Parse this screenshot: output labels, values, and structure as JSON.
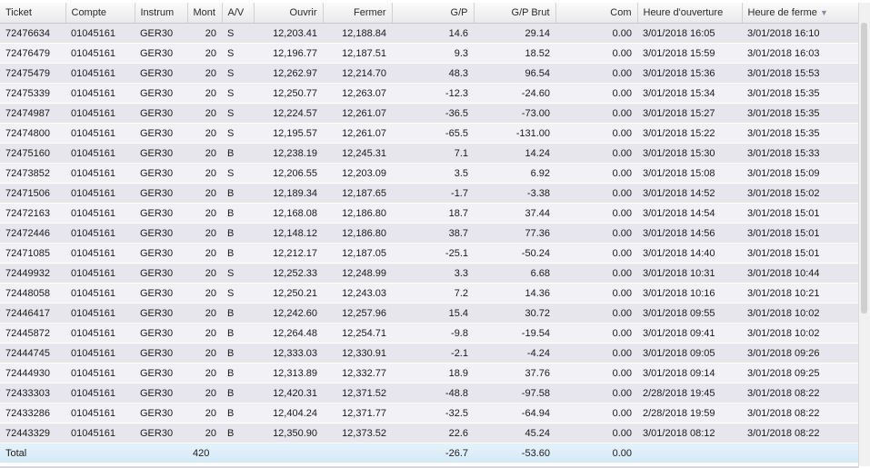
{
  "columns": [
    "Ticket",
    "Compte",
    "Instrum",
    "Mont",
    "A/V",
    "Ouvrir",
    "Fermer",
    "G/P",
    "G/P Brut",
    "Com",
    "Heure d'ouverture",
    "Heure de ferme"
  ],
  "sort_icon": "▼",
  "rows": [
    [
      "72476634",
      "01045161",
      "GER30",
      "20",
      "S",
      "12,203.41",
      "12,188.84",
      "14.6",
      "29.14",
      "0.00",
      "3/01/2018 16:05",
      "3/01/2018 16:10"
    ],
    [
      "72476479",
      "01045161",
      "GER30",
      "20",
      "S",
      "12,196.77",
      "12,187.51",
      "9.3",
      "18.52",
      "0.00",
      "3/01/2018 15:59",
      "3/01/2018 16:03"
    ],
    [
      "72475479",
      "01045161",
      "GER30",
      "20",
      "S",
      "12,262.97",
      "12,214.70",
      "48.3",
      "96.54",
      "0.00",
      "3/01/2018 15:36",
      "3/01/2018 15:53"
    ],
    [
      "72475339",
      "01045161",
      "GER30",
      "20",
      "S",
      "12,250.77",
      "12,263.07",
      "-12.3",
      "-24.60",
      "0.00",
      "3/01/2018 15:34",
      "3/01/2018 15:35"
    ],
    [
      "72474987",
      "01045161",
      "GER30",
      "20",
      "S",
      "12,224.57",
      "12,261.07",
      "-36.5",
      "-73.00",
      "0.00",
      "3/01/2018 15:27",
      "3/01/2018 15:35"
    ],
    [
      "72474800",
      "01045161",
      "GER30",
      "20",
      "S",
      "12,195.57",
      "12,261.07",
      "-65.5",
      "-131.00",
      "0.00",
      "3/01/2018 15:22",
      "3/01/2018 15:35"
    ],
    [
      "72475160",
      "01045161",
      "GER30",
      "20",
      "B",
      "12,238.19",
      "12,245.31",
      "7.1",
      "14.24",
      "0.00",
      "3/01/2018 15:30",
      "3/01/2018 15:33"
    ],
    [
      "72473852",
      "01045161",
      "GER30",
      "20",
      "S",
      "12,206.55",
      "12,203.09",
      "3.5",
      "6.92",
      "0.00",
      "3/01/2018 15:08",
      "3/01/2018 15:09"
    ],
    [
      "72471506",
      "01045161",
      "GER30",
      "20",
      "B",
      "12,189.34",
      "12,187.65",
      "-1.7",
      "-3.38",
      "0.00",
      "3/01/2018 14:52",
      "3/01/2018 15:02"
    ],
    [
      "72472163",
      "01045161",
      "GER30",
      "20",
      "B",
      "12,168.08",
      "12,186.80",
      "18.7",
      "37.44",
      "0.00",
      "3/01/2018 14:54",
      "3/01/2018 15:01"
    ],
    [
      "72472446",
      "01045161",
      "GER30",
      "20",
      "B",
      "12,148.12",
      "12,186.80",
      "38.7",
      "77.36",
      "0.00",
      "3/01/2018 14:56",
      "3/01/2018 15:01"
    ],
    [
      "72471085",
      "01045161",
      "GER30",
      "20",
      "B",
      "12,212.17",
      "12,187.05",
      "-25.1",
      "-50.24",
      "0.00",
      "3/01/2018 14:40",
      "3/01/2018 15:01"
    ],
    [
      "72449932",
      "01045161",
      "GER30",
      "20",
      "S",
      "12,252.33",
      "12,248.99",
      "3.3",
      "6.68",
      "0.00",
      "3/01/2018 10:31",
      "3/01/2018 10:44"
    ],
    [
      "72448058",
      "01045161",
      "GER30",
      "20",
      "S",
      "12,250.21",
      "12,243.03",
      "7.2",
      "14.36",
      "0.00",
      "3/01/2018 10:16",
      "3/01/2018 10:21"
    ],
    [
      "72446417",
      "01045161",
      "GER30",
      "20",
      "B",
      "12,242.60",
      "12,257.96",
      "15.4",
      "30.72",
      "0.00",
      "3/01/2018 09:55",
      "3/01/2018 10:02"
    ],
    [
      "72445872",
      "01045161",
      "GER30",
      "20",
      "B",
      "12,264.48",
      "12,254.71",
      "-9.8",
      "-19.54",
      "0.00",
      "3/01/2018 09:41",
      "3/01/2018 10:02"
    ],
    [
      "72444745",
      "01045161",
      "GER30",
      "20",
      "B",
      "12,333.03",
      "12,330.91",
      "-2.1",
      "-4.24",
      "0.00",
      "3/01/2018 09:05",
      "3/01/2018 09:26"
    ],
    [
      "72444930",
      "01045161",
      "GER30",
      "20",
      "B",
      "12,313.89",
      "12,332.77",
      "18.9",
      "37.76",
      "0.00",
      "3/01/2018 09:14",
      "3/01/2018 09:25"
    ],
    [
      "72433303",
      "01045161",
      "GER30",
      "20",
      "B",
      "12,420.31",
      "12,371.52",
      "-48.8",
      "-97.58",
      "0.00",
      "2/28/2018 19:45",
      "3/01/2018 08:22"
    ],
    [
      "72433286",
      "01045161",
      "GER30",
      "20",
      "B",
      "12,404.24",
      "12,371.77",
      "-32.5",
      "-64.94",
      "0.00",
      "2/28/2018 19:59",
      "3/01/2018 08:22"
    ],
    [
      "72443329",
      "01045161",
      "GER30",
      "20",
      "B",
      "12,350.90",
      "12,373.52",
      "22.6",
      "45.24",
      "0.00",
      "3/01/2018 08:12",
      "3/01/2018 08:22"
    ]
  ],
  "total": {
    "label": "Total",
    "mont": "420",
    "gp": "-26.7",
    "gp_brut": "-53.60",
    "com": "0.00"
  }
}
